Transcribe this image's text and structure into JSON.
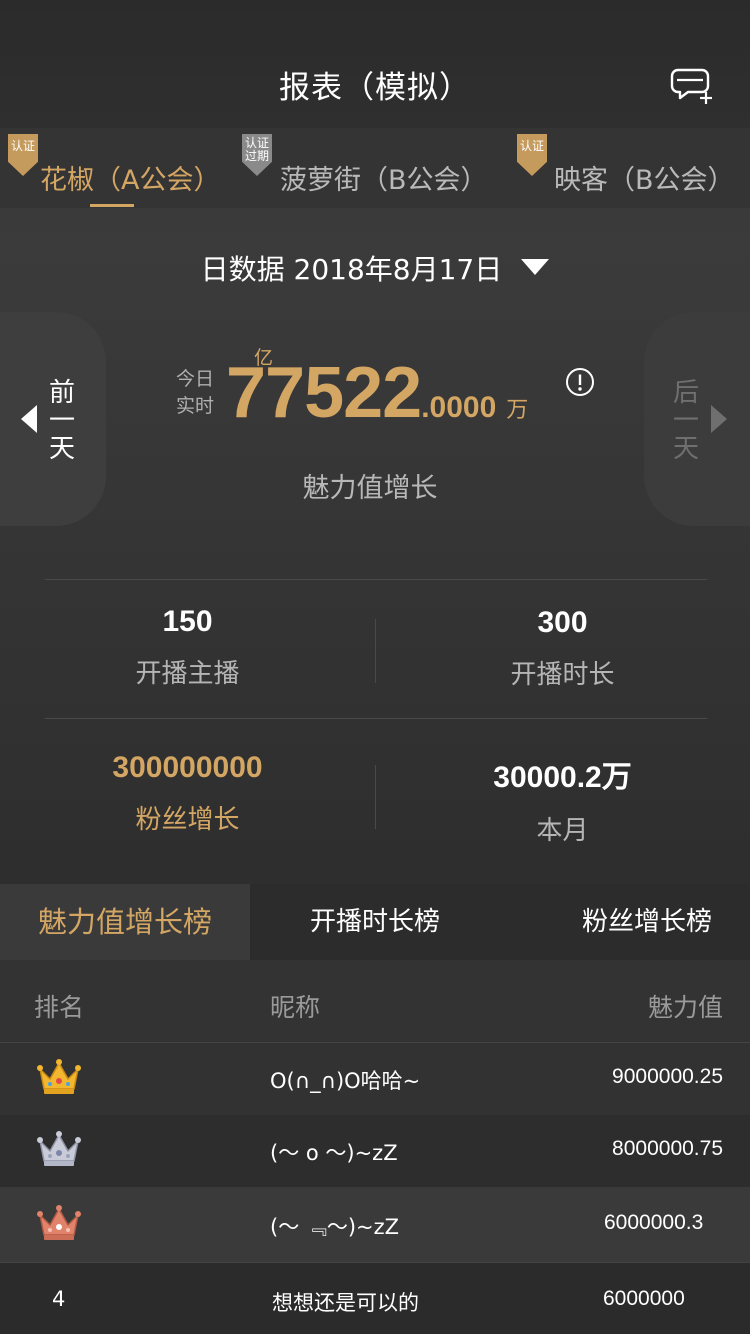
{
  "header": {
    "title": "报表（模拟）",
    "action_icon": "chat-add-icon"
  },
  "guild_tabs": [
    {
      "name": "花椒（A公会）",
      "badge": "认证",
      "badge_color": "#c59a5d",
      "active": true
    },
    {
      "name": "菠萝街（B公会）",
      "badge": "认证过期",
      "badge_color": "#8a8a8a",
      "active": false
    },
    {
      "name": "映客（B公会）",
      "badge": "认证",
      "badge_color": "#c59a5d",
      "active": false
    }
  ],
  "date_picker": {
    "label": "日数据 2018年8月17日",
    "caret_icon": "caret-down-icon"
  },
  "hero": {
    "prev_day": {
      "label_top": "前",
      "label_mid": "一",
      "label_bottom": "天"
    },
    "next_day": {
      "label_top": "后",
      "label_mid": "一",
      "label_bottom": "天"
    },
    "today_label": "今日 实时",
    "unit_yi": "亿",
    "value_int": "77522",
    "value_dec": ".0000",
    "unit_wan": "万",
    "info_icon": "info-icon",
    "subtitle": "魅力值增长"
  },
  "stats": [
    {
      "value": "150",
      "label": "开播主播",
      "highlight": false
    },
    {
      "value": "300",
      "label": "开播时长",
      "highlight": false
    },
    {
      "value": "300000000",
      "label": "粉丝增长",
      "highlight": true
    },
    {
      "value": "30000.2万",
      "label": "本月",
      "highlight": false
    }
  ],
  "rank_tabs": [
    {
      "label": "魅力值增长榜",
      "active": true
    },
    {
      "label": "开播时长榜",
      "active": false
    },
    {
      "label": "粉丝增长榜",
      "active": false
    }
  ],
  "table": {
    "columns": [
      "排名",
      "昵称",
      "魅力值"
    ],
    "rows": [
      {
        "rank": "1",
        "rank_icon": "gold-crown-icon",
        "nickname": "O(∩_∩)O哈哈~",
        "value": "9000000.25"
      },
      {
        "rank": "2",
        "rank_icon": "silver-crown-icon",
        "nickname": "(～ o ～)~zZ",
        "value": "8000000.75"
      },
      {
        "rank": "3",
        "rank_icon": "bronze-crown-icon",
        "nickname": "(～ ﹃～)~zZ",
        "value": "6000000.3"
      },
      {
        "rank": "4",
        "rank_icon": "",
        "nickname": "想想还是可以的",
        "value": "6000000"
      }
    ]
  },
  "colors": {
    "accent_gold": "#d4a664",
    "background": "#333333",
    "crown_gold": "#f2b62f",
    "crown_silver": "#c9ccd8",
    "crown_bronze": "#e0836a"
  }
}
